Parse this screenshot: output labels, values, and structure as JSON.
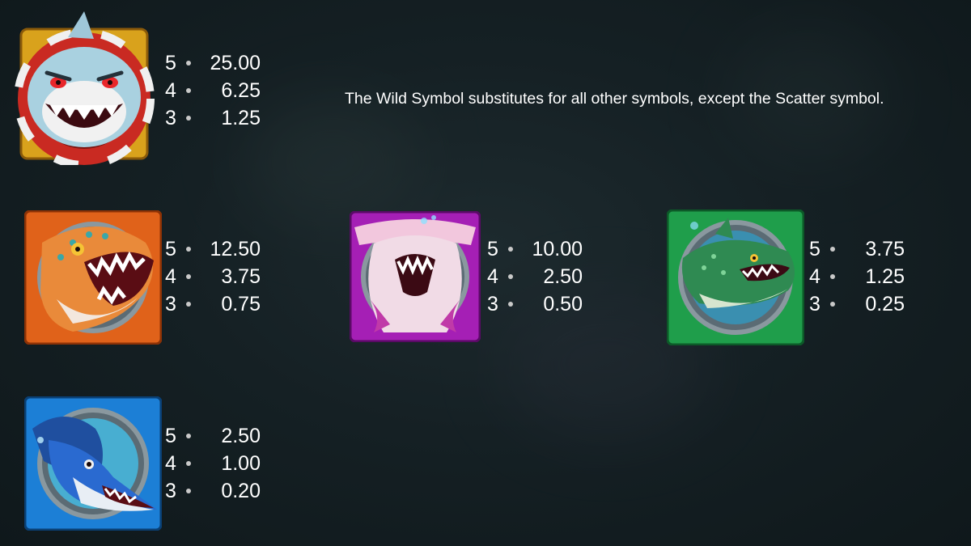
{
  "wild_description": "The Wild Symbol substitutes for all other symbols, except the Scatter symbol.",
  "symbols": [
    {
      "name": "wild-shark",
      "icon": "wild-shark-icon",
      "frame_color": "#c9251f",
      "payouts": [
        {
          "count": "5",
          "value": "25.00"
        },
        {
          "count": "4",
          "value": "6.25"
        },
        {
          "count": "3",
          "value": "1.25"
        }
      ]
    },
    {
      "name": "orange-shark",
      "icon": "orange-shark-icon",
      "frame_color": "#e0621a",
      "payouts": [
        {
          "count": "5",
          "value": "12.50"
        },
        {
          "count": "4",
          "value": "3.75"
        },
        {
          "count": "3",
          "value": "0.75"
        }
      ]
    },
    {
      "name": "pink-hammerhead",
      "icon": "pink-hammerhead-icon",
      "frame_color": "#a51fb5",
      "payouts": [
        {
          "count": "5",
          "value": "10.00"
        },
        {
          "count": "4",
          "value": "2.50"
        },
        {
          "count": "3",
          "value": "0.50"
        }
      ]
    },
    {
      "name": "green-whale-shark",
      "icon": "green-whale-shark-icon",
      "frame_color": "#1f9e4b",
      "payouts": [
        {
          "count": "5",
          "value": "3.75"
        },
        {
          "count": "4",
          "value": "1.25"
        },
        {
          "count": "3",
          "value": "0.25"
        }
      ]
    },
    {
      "name": "blue-swordfish",
      "icon": "blue-swordfish-icon",
      "frame_color": "#1c7fd6",
      "payouts": [
        {
          "count": "5",
          "value": "2.50"
        },
        {
          "count": "4",
          "value": "1.00"
        },
        {
          "count": "3",
          "value": "0.20"
        }
      ]
    }
  ]
}
